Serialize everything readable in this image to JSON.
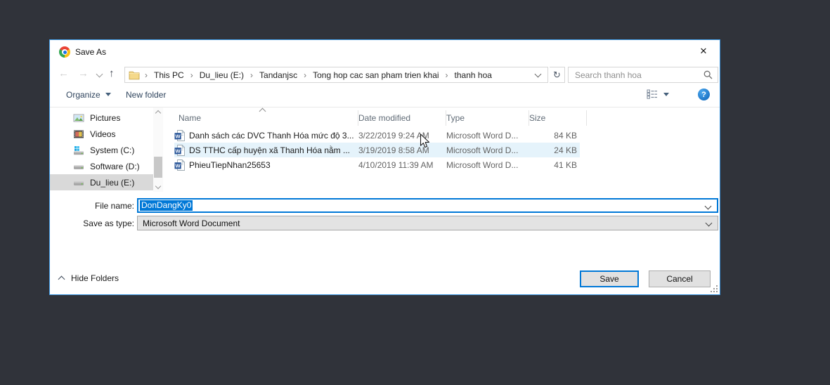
{
  "window": {
    "title": "Save As"
  },
  "icons": {
    "close": "✕",
    "back": "←",
    "forward": "→",
    "up": "↑",
    "refresh": "↻",
    "crumb_sep": "›",
    "help": "?"
  },
  "nav": {
    "breadcrumb": [
      "This PC",
      "Du_lieu (E:)",
      "Tandanjsc",
      "Tong hop cac san pham trien khai",
      "thanh hoa"
    ],
    "search_placeholder": "Search thanh hoa"
  },
  "toolbar": {
    "organize_label": "Organize",
    "new_folder_label": "New folder"
  },
  "sidebar": {
    "items": [
      {
        "label": "Pictures",
        "icon": "pictures"
      },
      {
        "label": "Videos",
        "icon": "videos"
      },
      {
        "label": "System (C:)",
        "icon": "drive-system"
      },
      {
        "label": "Software (D:)",
        "icon": "drive"
      },
      {
        "label": "Du_lieu (E:)",
        "icon": "drive",
        "state": "selected"
      }
    ]
  },
  "files": {
    "columns": [
      "Name",
      "Date modified",
      "Type",
      "Size"
    ],
    "rows": [
      {
        "name": "Danh sách các DVC Thanh Hóa mức độ 3...",
        "date": "3/22/2019 9:24 AM",
        "type": "Microsoft Word D...",
        "size": "84 KB"
      },
      {
        "name": "DS TTHC cấp huyện xã Thanh Hóa nằm ...",
        "date": "3/19/2019 8:58 AM",
        "type": "Microsoft Word D...",
        "size": "24 KB",
        "state": "hover"
      },
      {
        "name": "PhieuTiepNhan25653",
        "date": "4/10/2019 11:39 AM",
        "type": "Microsoft Word D...",
        "size": "41 KB"
      }
    ]
  },
  "fields": {
    "file_name_label": "File name:",
    "file_name_value": "DonDangKy0",
    "save_as_type_label": "Save as type:",
    "save_as_type_value": "Microsoft Word Document"
  },
  "footer": {
    "hide_folders_label": "Hide Folders",
    "save_label": "Save",
    "cancel_label": "Cancel"
  },
  "colors": {
    "accent": "#0078d7",
    "selection": "#0078d7",
    "hover_row": "#e5f3fb",
    "dialog_border": "#3794e0",
    "desktop_background": "#30333a"
  }
}
